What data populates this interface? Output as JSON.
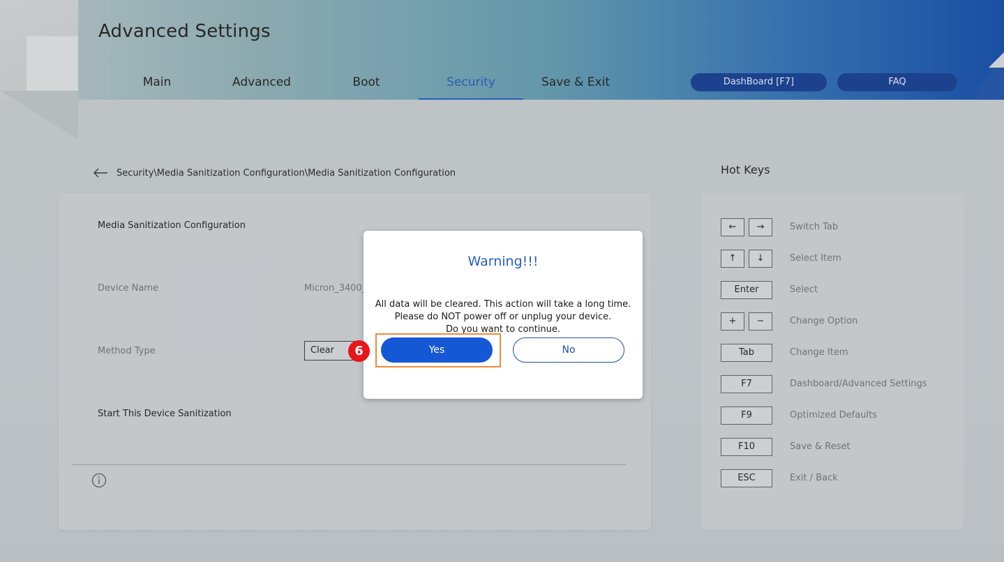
{
  "header": {
    "title": "Advanced Settings",
    "tabs": [
      {
        "label": "Main"
      },
      {
        "label": "Advanced"
      },
      {
        "label": "Boot"
      },
      {
        "label": "Security"
      },
      {
        "label": "Save & Exit"
      }
    ],
    "active_tab": "Security",
    "dashboard_label": "DashBoard [F7]",
    "faq_label": "FAQ"
  },
  "breadcrumb": {
    "path": "Security\\Media Sanitization Configuration\\Media Sanitization Configuration"
  },
  "panel": {
    "section_title": "Media Sanitization Configuration",
    "device_name_label": "Device Name",
    "device_name_value": "Micron_3400_",
    "method_type_label": "Method Type",
    "method_type_value": "Clear",
    "start_label": "Start This Device Sanitization"
  },
  "hotkeys": {
    "title": "Hot Keys",
    "items": [
      {
        "keys": [
          "←",
          "→"
        ],
        "desc": "Switch Tab"
      },
      {
        "keys": [
          "↑",
          "↓"
        ],
        "desc": "Select Item"
      },
      {
        "keys": [
          "Enter"
        ],
        "desc": "Select"
      },
      {
        "keys": [
          "+",
          "−"
        ],
        "desc": "Change Option"
      },
      {
        "keys": [
          "Tab"
        ],
        "desc": "Change Item"
      },
      {
        "keys": [
          "F7"
        ],
        "desc": "Dashboard/Advanced Settings"
      },
      {
        "keys": [
          "F9"
        ],
        "desc": "Optimized Defaults"
      },
      {
        "keys": [
          "F10"
        ],
        "desc": "Save & Reset"
      },
      {
        "keys": [
          "ESC"
        ],
        "desc": "Exit / Back"
      }
    ]
  },
  "dialog": {
    "title": "Warning!!!",
    "line1": "All data will be cleared. This action will take a long time.",
    "line2": "Please do NOT power off or unplug your device.",
    "line3": "Do you want to continue.",
    "yes_label": "Yes",
    "no_label": "No"
  },
  "annotation": {
    "step_number": "6",
    "highlight_color": "#ef8a3c",
    "badge_color": "#e8151b"
  },
  "colors": {
    "accent": "#1f58b8",
    "primary_button": "#1458d6",
    "pill_button": "#0f3a8f"
  }
}
